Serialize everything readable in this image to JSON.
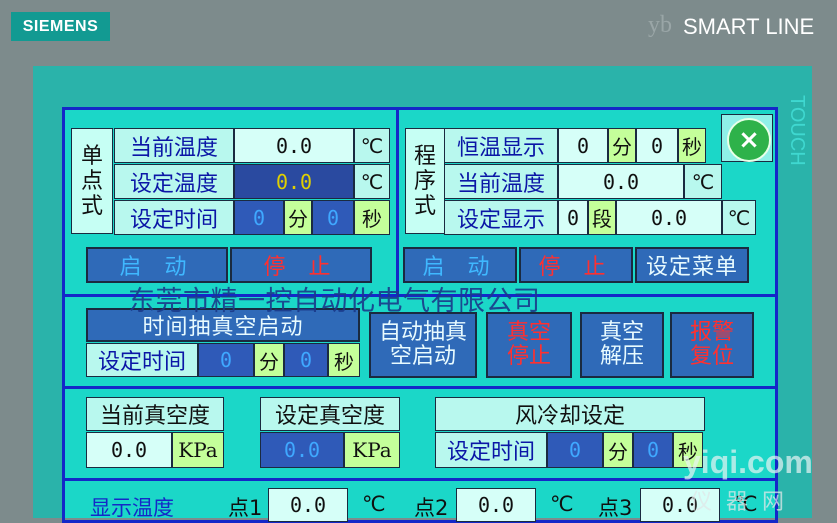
{
  "device": {
    "logo": "SIEMENS",
    "brand": "SMART LINE",
    "side_label": "TOUCH",
    "corner_mark": "yb"
  },
  "single": {
    "title_chars": [
      "单",
      "点",
      "式"
    ],
    "cur_temp_label": "当前温度",
    "cur_temp_value": "0.0",
    "cur_temp_unit": "℃",
    "set_temp_label": "设定温度",
    "set_temp_value": "0.0",
    "set_temp_unit": "℃",
    "set_time_label": "设定时间",
    "time_min_value": "0",
    "min_unit": "分",
    "time_sec_value": "0",
    "sec_unit": "秒",
    "start_label": "启 动",
    "stop_label": "停 止"
  },
  "program": {
    "title_chars": [
      "程",
      "序",
      "式"
    ],
    "hold_label": "恒温显示",
    "hold_min": "0",
    "min_unit": "分",
    "hold_sec": "0",
    "sec_unit": "秒",
    "cur_temp_label": "当前温度",
    "cur_temp_value": "0.0",
    "cur_temp_unit": "℃",
    "set_disp_label": "设定显示",
    "seg_value": "0",
    "seg_unit": "段",
    "set_temp_value": "0.0",
    "set_temp_unit": "℃",
    "start_label": "启 动",
    "stop_label": "停 止",
    "menu_label": "设定菜单"
  },
  "close_icon": "×",
  "overlay_text": "东莞市精一控自动化电气有限公司",
  "vacuum": {
    "timed_start_label": "时间抽真空启动",
    "set_time_label": "设定时间",
    "min_value": "0",
    "min_unit": "分",
    "sec_value": "0",
    "sec_unit": "秒",
    "auto_start_label_1": "自动抽真",
    "auto_start_label_2": "空启动",
    "stop_label_1": "真空",
    "stop_label_2": "停止",
    "release_label_1": "真空",
    "release_label_2": "解压",
    "alarm_reset_label_1": "报警",
    "alarm_reset_label_2": "复位"
  },
  "vacuum_readout": {
    "cur_label": "当前真空度",
    "cur_value": "0.0",
    "cur_unit": "KPa",
    "set_label": "设定真空度",
    "set_value": "0.0",
    "set_unit": "KPa"
  },
  "air_cool": {
    "title": "风冷却设定",
    "set_time_label": "设定时间",
    "min_value": "0",
    "min_unit": "分",
    "sec_value": "0",
    "sec_unit": "秒"
  },
  "temps": {
    "label": "显示温度",
    "p1_label": "点1",
    "p1_value": "0.0",
    "p1_unit": "℃",
    "p2_label": "点2",
    "p2_value": "0.0",
    "p2_unit": "℃",
    "p3_label": "点3",
    "p3_value": "0.0",
    "p3_unit": "℃"
  },
  "watermark": {
    "site": "yiqi.com",
    "sub": "仪器网"
  },
  "colors": {
    "bezel": "#2ab3aa",
    "screen": "#1bd7c8",
    "frame": "#1428c8",
    "button": "#2f6ab8",
    "close": "#2eb24a"
  }
}
